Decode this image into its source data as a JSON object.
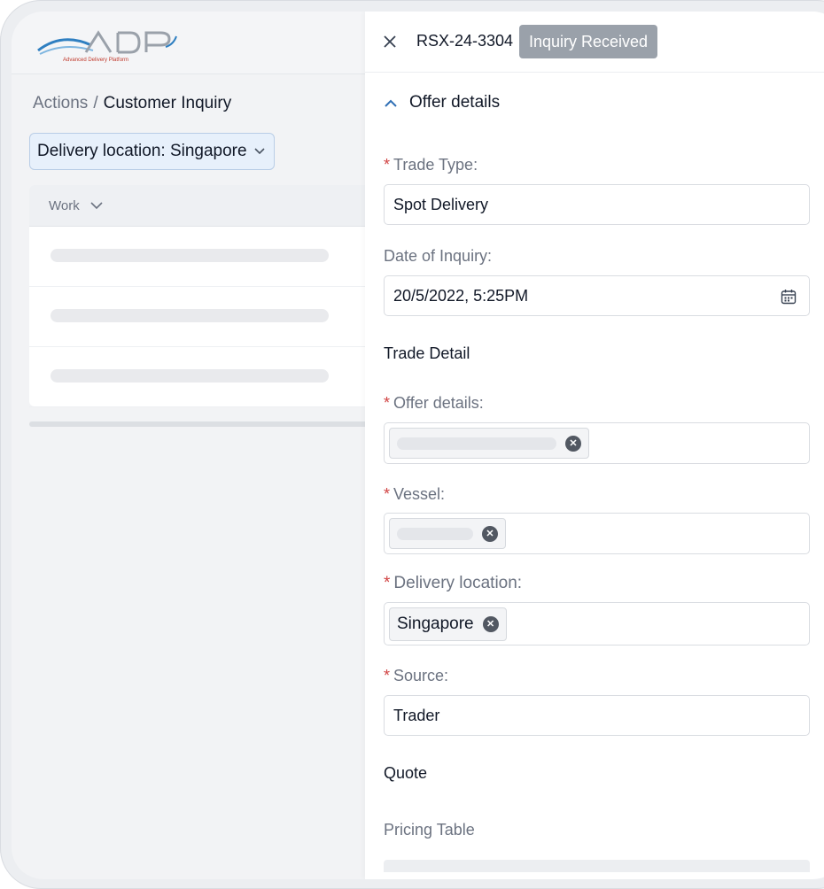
{
  "app": {
    "logo_text": "ADP",
    "logo_tagline": "Advanced Delivery Platform"
  },
  "breadcrumb": {
    "parent": "Actions",
    "separator": "/",
    "current": "Customer Inquiry"
  },
  "filter": {
    "label": "Delivery location: Singapore"
  },
  "table": {
    "column_header": "Work"
  },
  "drawer": {
    "close_icon": "close-icon",
    "reference": "RSX-24-3304",
    "status": "Inquiry Received",
    "section_title": "Offer details",
    "fields": {
      "trade_type": {
        "label": "Trade Type:",
        "required": "*",
        "value": "Spot Delivery"
      },
      "date_of_inquiry": {
        "label": "Date of Inquiry:",
        "value": "20/5/2022, 5:25PM"
      },
      "trade_detail_heading": "Trade Detail",
      "offer_details": {
        "label": "Offer details:",
        "required": "*"
      },
      "vessel": {
        "label": "Vessel:",
        "required": "*"
      },
      "delivery_location": {
        "label": "Delivery location:",
        "required": "*",
        "tag": "Singapore"
      },
      "source": {
        "label": "Source:",
        "required": "*",
        "value": "Trader"
      }
    },
    "quote_heading": "Quote",
    "pricing_table_label": "Pricing Table"
  },
  "colors": {
    "accent": "#2f6fb5",
    "required": "#d14343",
    "badge": "#9aa1aa"
  }
}
